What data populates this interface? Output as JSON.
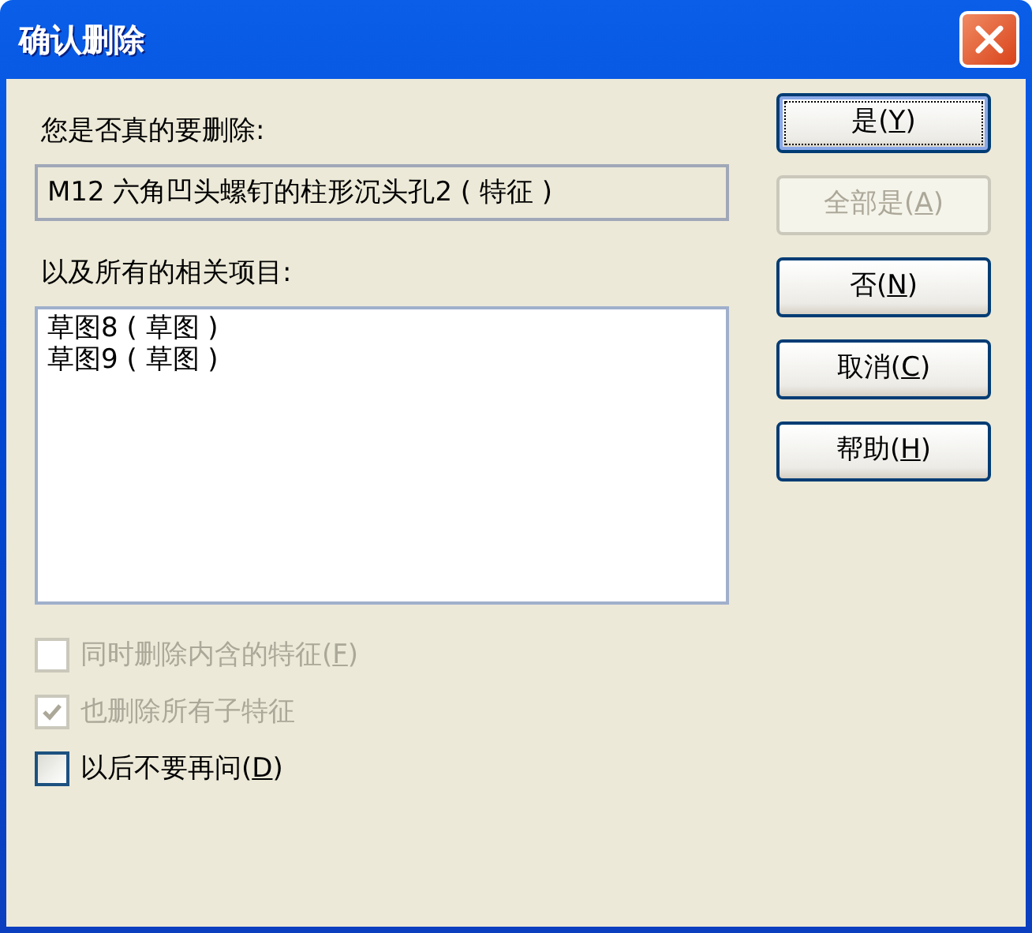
{
  "window": {
    "title": "确认删除"
  },
  "prompt": "您是否真的要删除:",
  "target": "M12 六角凹头螺钉的柱形沉头孔2 ( 特征 )",
  "related_label": "以及所有的相关项目:",
  "related_items": [
    "草图8 ( 草图 )",
    "草图9 ( 草图 )"
  ],
  "options": [
    {
      "before": "同时删除内含的特征(",
      "mnemonic": "F",
      "after": ")",
      "checked": false,
      "disabled": true
    },
    {
      "before": "也删除所有子特征",
      "checked": true,
      "disabled": true
    },
    {
      "before": "以后不要再问(",
      "mnemonic": "D",
      "after": ")",
      "checked": false,
      "disabled": false
    }
  ],
  "buttons": [
    {
      "before": "是(",
      "mnemonic": "Y",
      "after": ")",
      "disabled": false,
      "default": true
    },
    {
      "before": "全部是(",
      "mnemonic": "A",
      "after": ")",
      "disabled": true,
      "default": false
    },
    {
      "before": "否(",
      "mnemonic": "N",
      "after": ")",
      "disabled": false,
      "default": false
    },
    {
      "before": "取消(",
      "mnemonic": "C",
      "after": ")",
      "disabled": false,
      "default": false
    },
    {
      "before": "帮助(",
      "mnemonic": "H",
      "after": ")",
      "disabled": false,
      "default": false
    }
  ]
}
